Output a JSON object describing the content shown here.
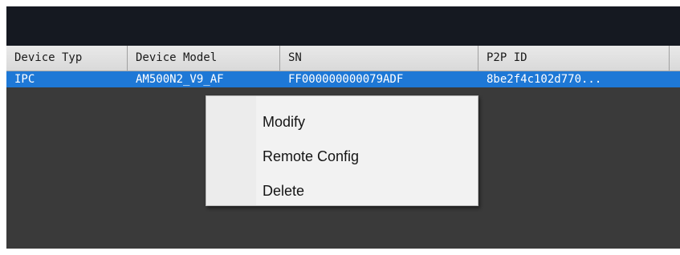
{
  "table": {
    "columns": [
      "Device Typ",
      "Device Model",
      "SN",
      "P2P ID",
      ""
    ],
    "rows": [
      {
        "type": "IPC",
        "model": "AM500N2_V9_AF",
        "sn": "FF000000000079ADF",
        "p2p": "8be2f4c102d770..."
      }
    ]
  },
  "context_menu": {
    "items": [
      "Modify",
      "Remote Config",
      "Delete"
    ]
  },
  "colors": {
    "selection": "#1e78d6",
    "topbar": "#151921",
    "panel_bg": "#3a3a3a"
  }
}
